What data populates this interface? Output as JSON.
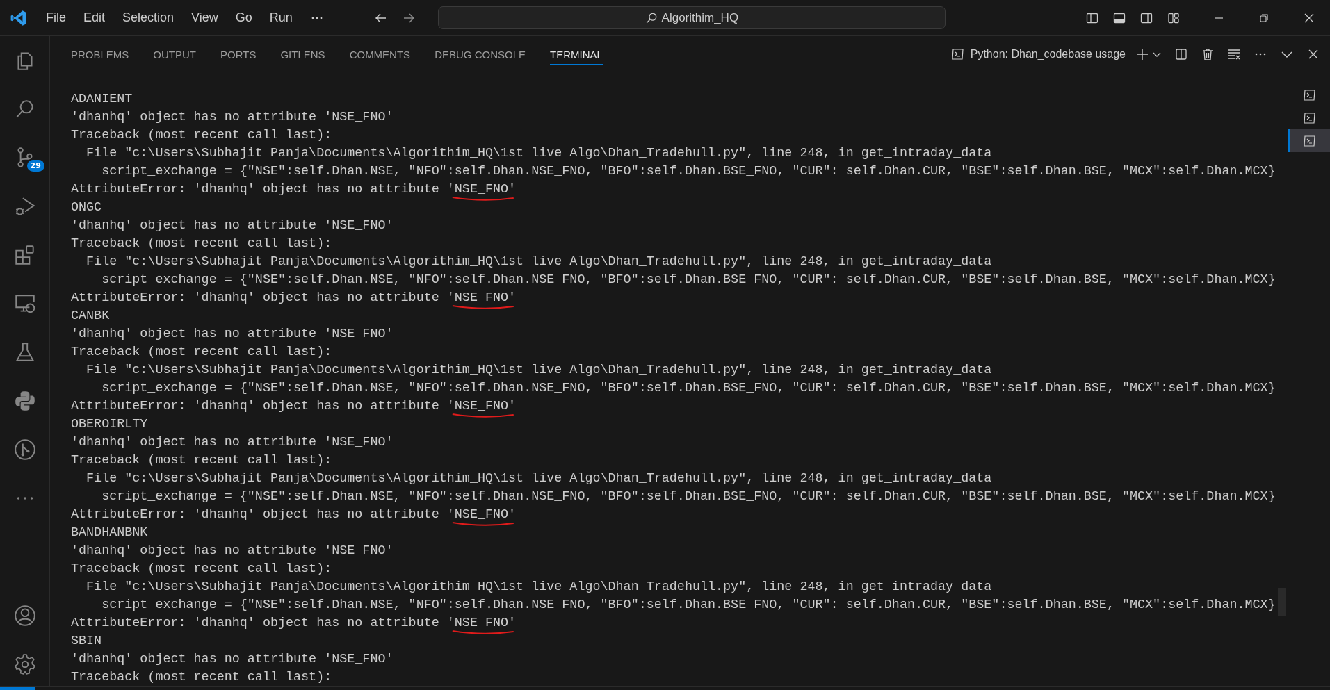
{
  "title_bar": {
    "menu": [
      "File",
      "Edit",
      "Selection",
      "View",
      "Go",
      "Run"
    ],
    "search": {
      "value": "Algorithim_HQ"
    }
  },
  "activity_bar": {
    "source_control_badge": "29"
  },
  "panel": {
    "tabs": [
      {
        "label": "PROBLEMS",
        "selected": false
      },
      {
        "label": "OUTPUT",
        "selected": false
      },
      {
        "label": "PORTS",
        "selected": false
      },
      {
        "label": "GITLENS",
        "selected": false
      },
      {
        "label": "COMMENTS",
        "selected": false
      },
      {
        "label": "DEBUG CONSOLE",
        "selected": false
      },
      {
        "label": "TERMINAL",
        "selected": true
      }
    ],
    "terminal_name": "Python: Dhan_codebase usage"
  },
  "terminal": {
    "lines": [
      {
        "text": "ADANIENT",
        "underlined": false
      },
      {
        "text": "'dhanhq' object has no attribute 'NSE_FNO'",
        "underlined": false
      },
      {
        "text": "Traceback (most recent call last):",
        "underlined": false
      },
      {
        "text": "  File \"c:\\Users\\Subhajit Panja\\Documents\\Algorithim_HQ\\1st live Algo\\Dhan_Tradehull.py\", line 248, in get_intraday_data",
        "underlined": false
      },
      {
        "text": "    script_exchange = {\"NSE\":self.Dhan.NSE, \"NFO\":self.Dhan.NSE_FNO, \"BFO\":self.Dhan.BSE_FNO, \"CUR\": self.Dhan.CUR, \"BSE\":self.Dhan.BSE, \"MCX\":self.Dhan.MCX}",
        "underlined": false
      },
      {
        "text": "AttributeError: 'dhanhq' object has no attribute 'NSE_FNO'",
        "underlined": true
      },
      {
        "text": "ONGC",
        "underlined": false
      },
      {
        "text": "'dhanhq' object has no attribute 'NSE_FNO'",
        "underlined": false
      },
      {
        "text": "Traceback (most recent call last):",
        "underlined": false
      },
      {
        "text": "  File \"c:\\Users\\Subhajit Panja\\Documents\\Algorithim_HQ\\1st live Algo\\Dhan_Tradehull.py\", line 248, in get_intraday_data",
        "underlined": false
      },
      {
        "text": "    script_exchange = {\"NSE\":self.Dhan.NSE, \"NFO\":self.Dhan.NSE_FNO, \"BFO\":self.Dhan.BSE_FNO, \"CUR\": self.Dhan.CUR, \"BSE\":self.Dhan.BSE, \"MCX\":self.Dhan.MCX}",
        "underlined": false
      },
      {
        "text": "AttributeError: 'dhanhq' object has no attribute 'NSE_FNO'",
        "underlined": true
      },
      {
        "text": "CANBK",
        "underlined": false
      },
      {
        "text": "'dhanhq' object has no attribute 'NSE_FNO'",
        "underlined": false
      },
      {
        "text": "Traceback (most recent call last):",
        "underlined": false
      },
      {
        "text": "  File \"c:\\Users\\Subhajit Panja\\Documents\\Algorithim_HQ\\1st live Algo\\Dhan_Tradehull.py\", line 248, in get_intraday_data",
        "underlined": false
      },
      {
        "text": "    script_exchange = {\"NSE\":self.Dhan.NSE, \"NFO\":self.Dhan.NSE_FNO, \"BFO\":self.Dhan.BSE_FNO, \"CUR\": self.Dhan.CUR, \"BSE\":self.Dhan.BSE, \"MCX\":self.Dhan.MCX}",
        "underlined": false
      },
      {
        "text": "AttributeError: 'dhanhq' object has no attribute 'NSE_FNO'",
        "underlined": true
      },
      {
        "text": "OBEROIRLTY",
        "underlined": false
      },
      {
        "text": "'dhanhq' object has no attribute 'NSE_FNO'",
        "underlined": false
      },
      {
        "text": "Traceback (most recent call last):",
        "underlined": false
      },
      {
        "text": "  File \"c:\\Users\\Subhajit Panja\\Documents\\Algorithim_HQ\\1st live Algo\\Dhan_Tradehull.py\", line 248, in get_intraday_data",
        "underlined": false
      },
      {
        "text": "    script_exchange = {\"NSE\":self.Dhan.NSE, \"NFO\":self.Dhan.NSE_FNO, \"BFO\":self.Dhan.BSE_FNO, \"CUR\": self.Dhan.CUR, \"BSE\":self.Dhan.BSE, \"MCX\":self.Dhan.MCX}",
        "underlined": false
      },
      {
        "text": "AttributeError: 'dhanhq' object has no attribute 'NSE_FNO'",
        "underlined": true
      },
      {
        "text": "BANDHANBNK",
        "underlined": false
      },
      {
        "text": "'dhanhq' object has no attribute 'NSE_FNO'",
        "underlined": false
      },
      {
        "text": "Traceback (most recent call last):",
        "underlined": false
      },
      {
        "text": "  File \"c:\\Users\\Subhajit Panja\\Documents\\Algorithim_HQ\\1st live Algo\\Dhan_Tradehull.py\", line 248, in get_intraday_data",
        "underlined": false
      },
      {
        "text": "    script_exchange = {\"NSE\":self.Dhan.NSE, \"NFO\":self.Dhan.NSE_FNO, \"BFO\":self.Dhan.BSE_FNO, \"CUR\": self.Dhan.CUR, \"BSE\":self.Dhan.BSE, \"MCX\":self.Dhan.MCX}",
        "underlined": false
      },
      {
        "text": "AttributeError: 'dhanhq' object has no attribute 'NSE_FNO'",
        "underlined": true
      },
      {
        "text": "SBIN",
        "underlined": false
      },
      {
        "text": "'dhanhq' object has no attribute 'NSE_FNO'",
        "underlined": false
      },
      {
        "text": "Traceback (most recent call last):",
        "underlined": false
      }
    ]
  },
  "terminal_list": [
    {
      "selected": false
    },
    {
      "selected": false
    },
    {
      "selected": true
    }
  ]
}
